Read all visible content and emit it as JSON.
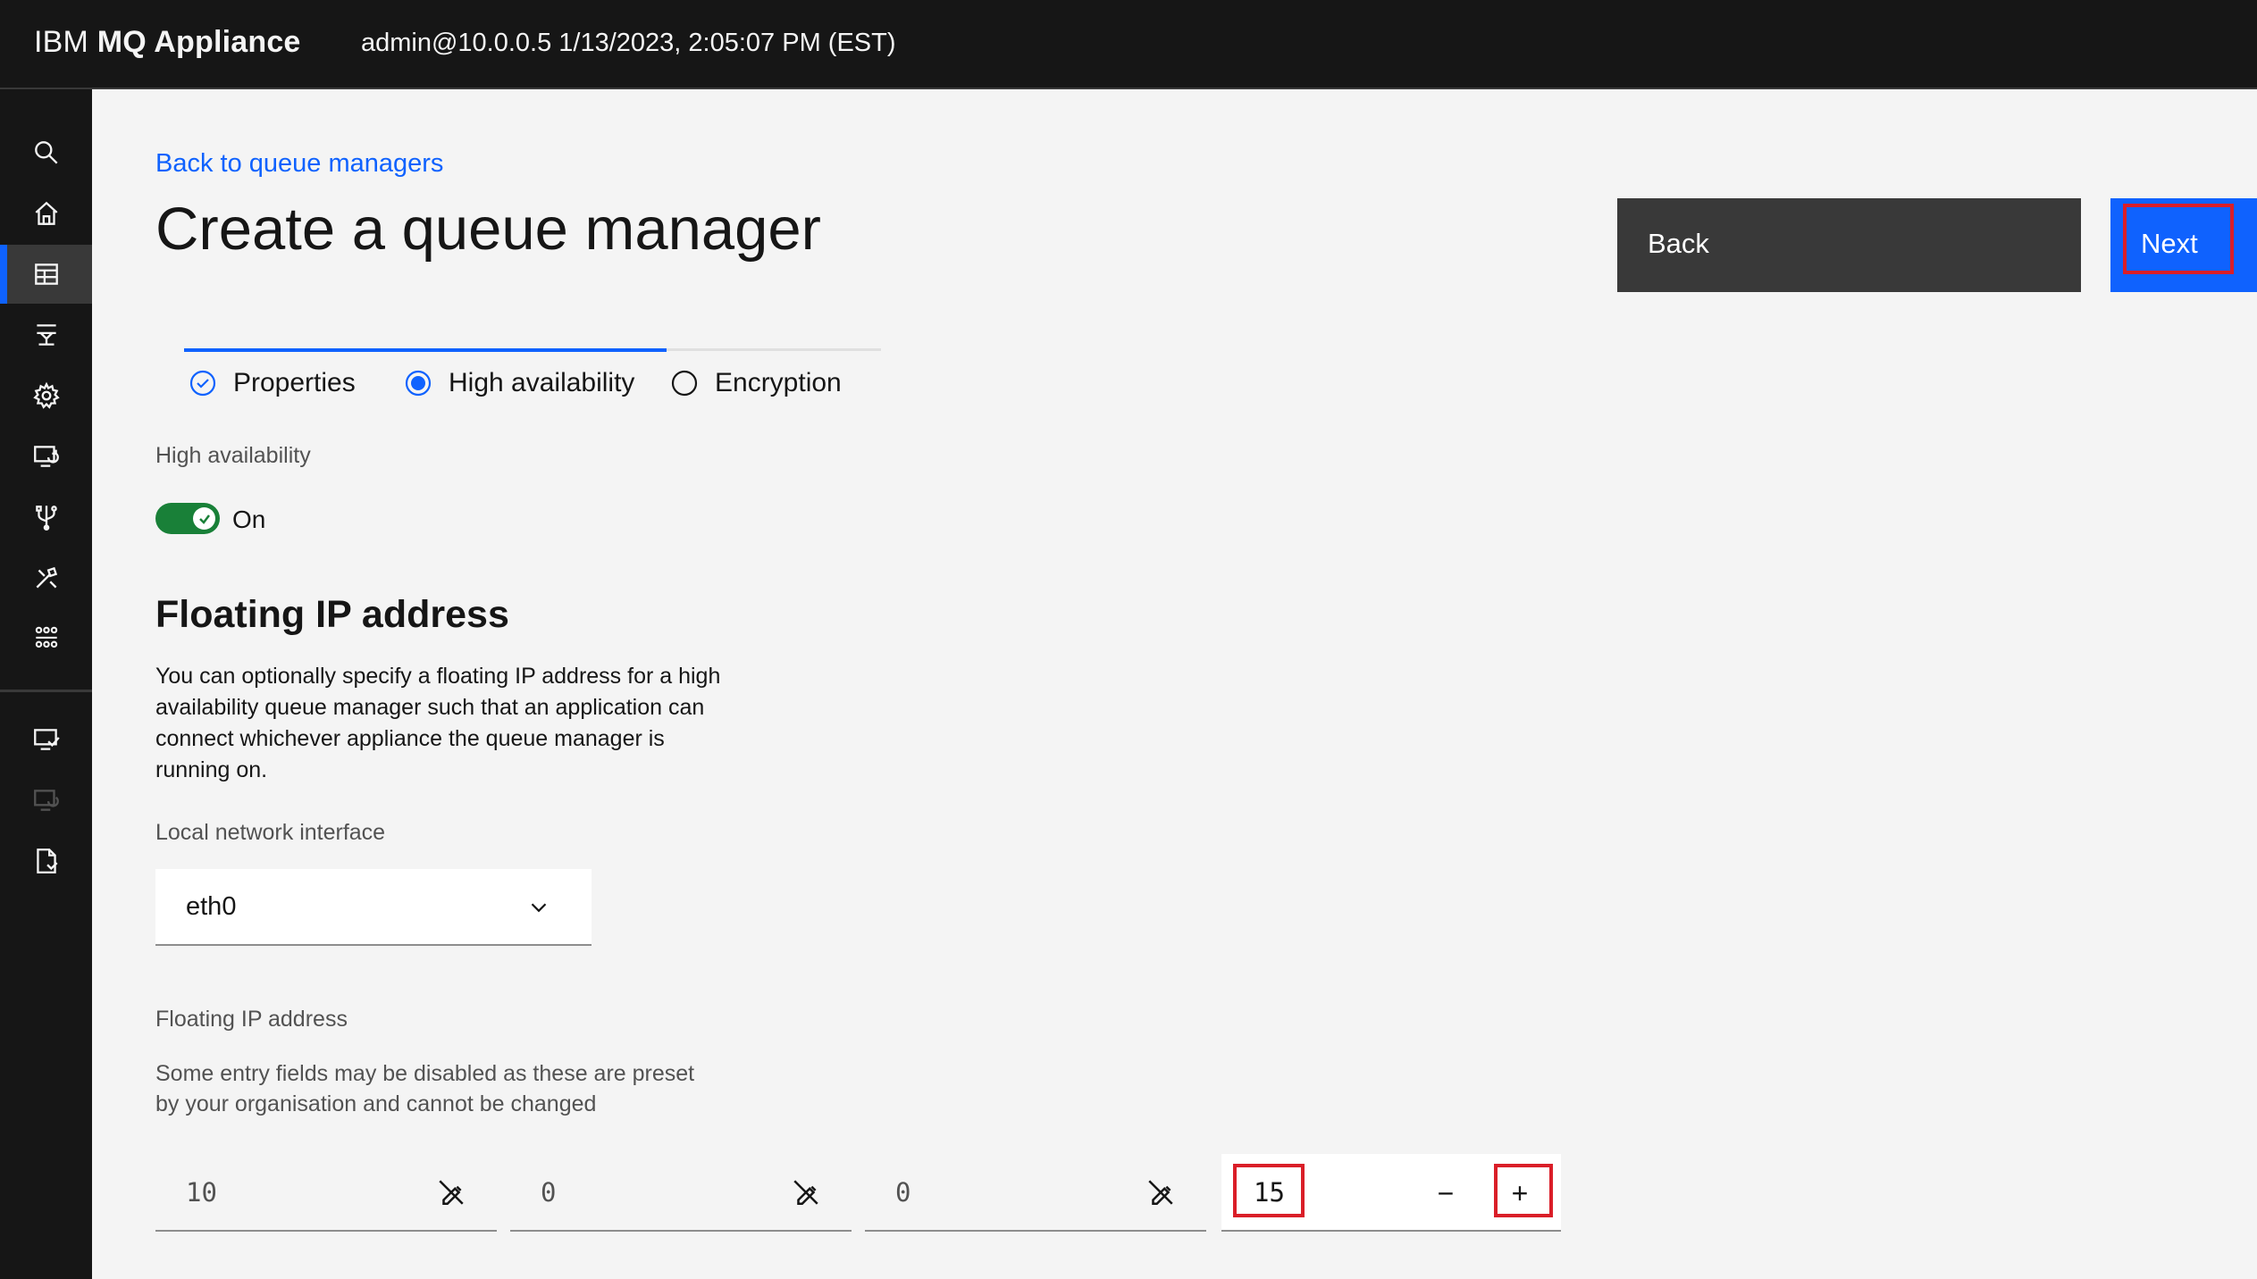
{
  "header": {
    "brand_prefix": "IBM",
    "brand_name": "MQ Appliance",
    "user_info": "admin@10.0.0.5 1/13/2023, 2:05:07 PM (EST)"
  },
  "rail": {
    "items": [
      "search-icon",
      "home-icon",
      "table-icon",
      "connect-icon",
      "settings-icon",
      "monitor-sync-icon",
      "usb-icon",
      "tools-icon",
      "grid-icon",
      "monitor-check-icon",
      "monitor-disabled-icon",
      "document-icon"
    ],
    "active_index": 2
  },
  "main": {
    "back_link": "Back to queue managers",
    "title": "Create a queue manager",
    "back_button": "Back",
    "next_button": "Next"
  },
  "progress": {
    "steps": [
      {
        "label": "Properties",
        "state": "complete"
      },
      {
        "label": "High availability",
        "state": "current"
      },
      {
        "label": "Encryption",
        "state": "incomplete"
      }
    ]
  },
  "high_availability": {
    "label": "High availability",
    "toggle_state": "On",
    "enabled": true
  },
  "floating_ip": {
    "section_title": "Floating IP address",
    "description": "You can optionally specify a floating IP address for a high availability queue manager such that an application can connect whichever appliance the queue manager is running on.",
    "interface_label": "Local network interface",
    "interface_value": "eth0",
    "address_label": "Floating IP address",
    "helper_text": "Some entry fields may be disabled as these are preset by your organisation and cannot be changed",
    "octets": [
      "10",
      "0",
      "0",
      "15"
    ],
    "decrement_label": "−",
    "increment_label": "+"
  },
  "colors": {
    "accent": "#0f62fe",
    "toggle_on": "#198038",
    "highlight": "#da1e28",
    "header_bg": "#161616"
  }
}
